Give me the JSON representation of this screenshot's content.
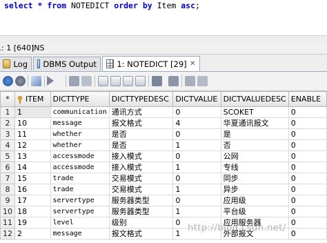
{
  "editor": {
    "sql": {
      "kw_select": "select",
      "star": " * ",
      "kw_from": "from",
      "table": " NOTEDICT ",
      "kw_order": "order by",
      "field": " Item ",
      "kw_asc": "asc",
      "end": ";"
    }
  },
  "status": {
    "position": "1: 1 [640]",
    "mode": "INS"
  },
  "tabs": [
    {
      "label": "Log"
    },
    {
      "label": "DBMS Output"
    },
    {
      "label": "1: NOTEDICT [29]"
    }
  ],
  "grid": {
    "columns": [
      "ITEM",
      "DICTTYPE",
      "DICTTYPEDESC",
      "DICTVALUE",
      "DICTVALUEDESC",
      "ENABLE"
    ],
    "rows": [
      [
        "1",
        "1",
        "communication",
        "通讯方式",
        "0",
        "SCOKET",
        "0"
      ],
      [
        "2",
        "10",
        "message",
        "报文格式",
        "4",
        "华夏通讯报文",
        "0"
      ],
      [
        "3",
        "11",
        "whether",
        "是否",
        "0",
        "是",
        "0"
      ],
      [
        "4",
        "12",
        "whether",
        "是否",
        "1",
        "否",
        "0"
      ],
      [
        "5",
        "13",
        "accessmode",
        "接入模式",
        "0",
        "公网",
        "0"
      ],
      [
        "6",
        "14",
        "accessmode",
        "接入模式",
        "1",
        "专线",
        "0"
      ],
      [
        "7",
        "15",
        "trade",
        "交易模式",
        "0",
        "同步",
        "0"
      ],
      [
        "8",
        "16",
        "trade",
        "交易模式",
        "1",
        "异步",
        "0"
      ],
      [
        "9",
        "17",
        "servertype",
        "服务器类型",
        "0",
        "应用级",
        "0"
      ],
      [
        "10",
        "18",
        "servertype",
        "服务器类型",
        "1",
        "平台级",
        "0"
      ],
      [
        "11",
        "19",
        "level",
        "级别",
        "0",
        "应用服务器",
        "0"
      ],
      [
        "12",
        "2",
        "message",
        "报文格式",
        "1",
        "外部报文",
        "0"
      ]
    ],
    "current_row_marker": "*"
  },
  "watermark": "http://blog.csdn.net/"
}
